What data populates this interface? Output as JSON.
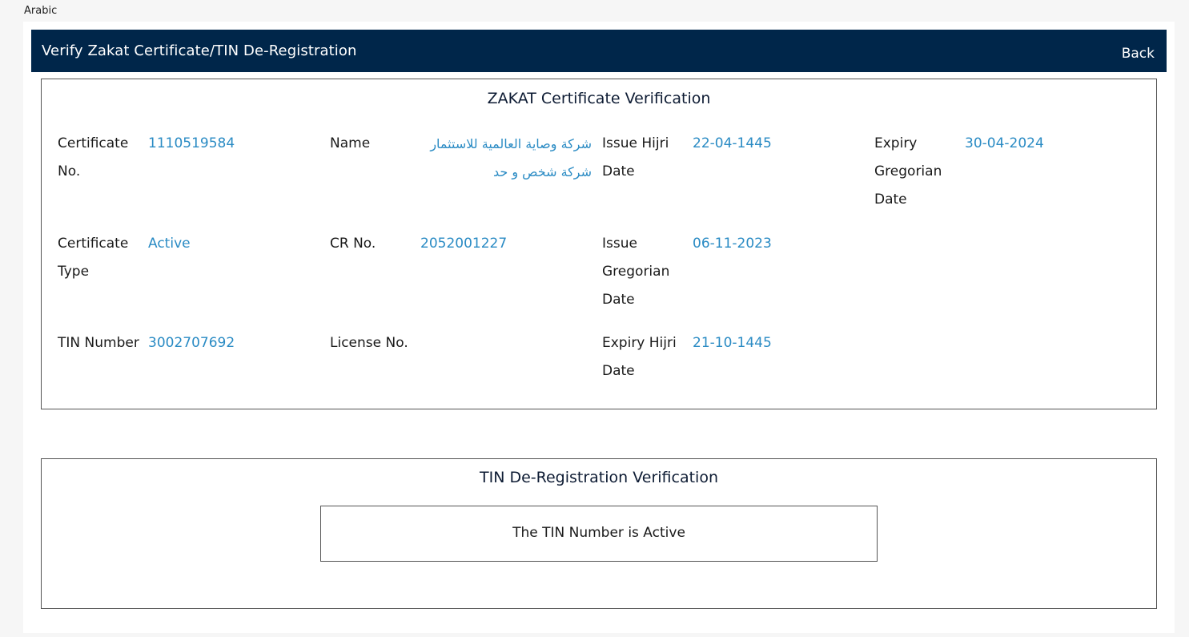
{
  "language_toggle": "Arabic",
  "header": {
    "title": "Verify Zakat Certificate/TIN De-Registration",
    "back_label": "Back"
  },
  "zakat": {
    "title": "ZAKAT Certificate Verification",
    "fields": {
      "certificate_no": {
        "label": "Certificate No.",
        "value": "1110519584"
      },
      "name": {
        "label": "Name",
        "value": "شركة وصاية العالمية للاستثمار شركة شخص و حد"
      },
      "issue_hijri_date": {
        "label": "Issue Hijri Date",
        "value": "22-04-1445"
      },
      "expiry_gregorian_date": {
        "label": "Expiry Gregorian Date",
        "value": "30-04-2024"
      },
      "certificate_type": {
        "label": "Certificate Type",
        "value": "Active"
      },
      "cr_no": {
        "label": "CR No.",
        "value": "2052001227"
      },
      "issue_gregorian_date": {
        "label": "Issue Gregorian Date",
        "value": "06-11-2023"
      },
      "tin_number": {
        "label": "TIN Number",
        "value": "3002707692"
      },
      "license_no": {
        "label": "License No.",
        "value": ""
      },
      "expiry_hijri_date": {
        "label": "Expiry Hijri Date",
        "value": "21-10-1445"
      }
    }
  },
  "tin": {
    "title": "TIN De-Registration Verification",
    "status_message": "The TIN Number is Active"
  },
  "colors": {
    "header_bg": "#00264a",
    "value_text": "#2a8bc4",
    "border": "#555555"
  }
}
